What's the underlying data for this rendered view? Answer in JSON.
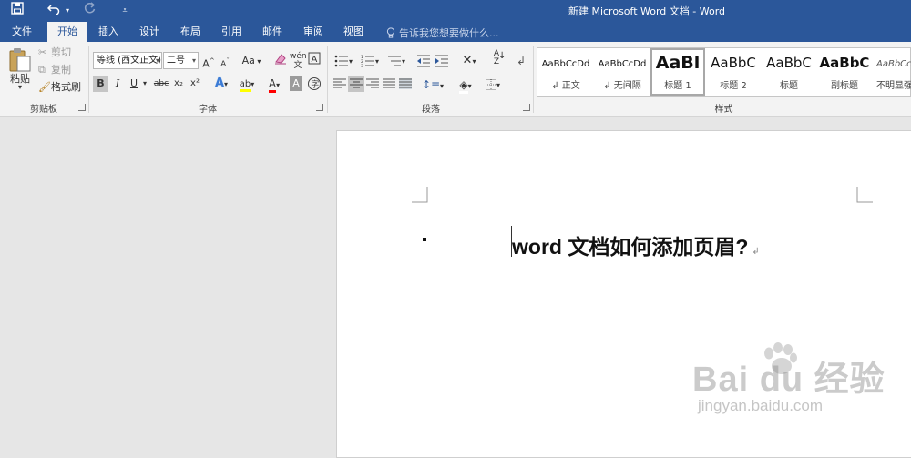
{
  "window": {
    "title": "新建 Microsoft Word 文档 - Word"
  },
  "qat": {
    "save_icon": "save-icon",
    "undo_icon": "undo-icon",
    "redo_icon": "redo-icon",
    "customize_icon": "customize-qat-icon"
  },
  "tabs": [
    {
      "label": "文件",
      "active": false
    },
    {
      "label": "开始",
      "active": true
    },
    {
      "label": "插入",
      "active": false
    },
    {
      "label": "设计",
      "active": false
    },
    {
      "label": "布局",
      "active": false
    },
    {
      "label": "引用",
      "active": false
    },
    {
      "label": "邮件",
      "active": false
    },
    {
      "label": "审阅",
      "active": false
    },
    {
      "label": "视图",
      "active": false
    }
  ],
  "tell_me": {
    "placeholder": "告诉我您想要做什么..."
  },
  "clipboard": {
    "paste_label": "粘贴",
    "cut_label": "剪切",
    "copy_label": "复制",
    "format_painter_label": "格式刷",
    "group_label": "剪贴板"
  },
  "font": {
    "font_name": "等线 (西文正文)",
    "font_size": "二号",
    "grow_label": "A",
    "shrink_label": "A",
    "case_label": "Aa",
    "bold_label": "B",
    "italic_label": "I",
    "underline_label": "U",
    "strike_label": "abc",
    "subscript_label": "x₂",
    "superscript_label": "x²",
    "font_color_label": "A",
    "shade_label": "A",
    "group_label": "字体"
  },
  "paragraph": {
    "group_label": "段落"
  },
  "styles": {
    "group_label": "样式",
    "items": [
      {
        "sample": "AaBbCcDd",
        "name": "正文"
      },
      {
        "sample": "AaBbCcDd",
        "name": "无间隔"
      },
      {
        "sample": "AaBl",
        "name": "标题 1"
      },
      {
        "sample": "AaBbC",
        "name": "标题 2"
      },
      {
        "sample": "AaBbC",
        "name": "标题"
      },
      {
        "sample": "AaBbC",
        "name": "副标题"
      },
      {
        "sample": "AaBbCcI",
        "name": "不明显强"
      }
    ]
  },
  "document": {
    "heading": "word 文档如何添加页眉?"
  },
  "watermark": {
    "logo": "Bai du 经验",
    "url": "jingyan.baidu.com"
  },
  "colors": {
    "brand_blue": "#2b579a",
    "font_color_red": "#ff0000",
    "highlight_yellow": "#ffff00"
  }
}
